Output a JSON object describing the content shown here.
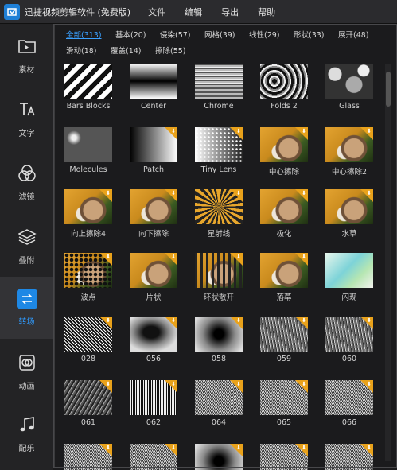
{
  "app": {
    "title": "迅捷视频剪辑软件 (免费版)"
  },
  "menu": [
    "文件",
    "编辑",
    "导出",
    "帮助"
  ],
  "sidebar": [
    {
      "label": "素材",
      "icon": "folder-icon",
      "active": false
    },
    {
      "label": "文字",
      "icon": "text-icon",
      "active": false
    },
    {
      "label": "滤镜",
      "icon": "filter-icon",
      "active": false
    },
    {
      "label": "叠附",
      "icon": "layers-icon",
      "active": false
    },
    {
      "label": "转场",
      "icon": "transition-icon",
      "active": true
    },
    {
      "label": "动画",
      "icon": "animation-icon",
      "active": false
    },
    {
      "label": "配乐",
      "icon": "music-icon",
      "active": false
    }
  ],
  "tabs": [
    {
      "label": "全部(313)",
      "active": true
    },
    {
      "label": "基本(20)"
    },
    {
      "label": "侵染(57)"
    },
    {
      "label": "网格(39)"
    },
    {
      "label": "线性(29)"
    },
    {
      "label": "形状(33)"
    },
    {
      "label": "展开(48)"
    },
    {
      "label": "滑动(18)"
    },
    {
      "label": "覆盖(14)"
    },
    {
      "label": "擦除(55)"
    }
  ],
  "transitions": [
    {
      "name": "Bars Blocks",
      "style": "bars",
      "download": false
    },
    {
      "name": "Center",
      "style": "center",
      "download": false
    },
    {
      "name": "Chrome",
      "style": "chrome",
      "download": false
    },
    {
      "name": "Folds 2",
      "style": "folds",
      "download": false
    },
    {
      "name": "Glass",
      "style": "glass",
      "download": false
    },
    {
      "name": "Molecules",
      "style": "molecules",
      "download": false
    },
    {
      "name": "Patch",
      "style": "patch",
      "download": true
    },
    {
      "name": "Tiny Lens",
      "style": "tinylens",
      "download": true
    },
    {
      "name": "中心擦除",
      "style": "cat",
      "download": true
    },
    {
      "name": "中心擦除2",
      "style": "cat",
      "download": true
    },
    {
      "name": "向上擦除4",
      "style": "cat",
      "download": true
    },
    {
      "name": "向下擦除",
      "style": "cat",
      "download": true
    },
    {
      "name": "星射线",
      "style": "rays",
      "download": true
    },
    {
      "name": "极化",
      "style": "cat",
      "download": true
    },
    {
      "name": "水草",
      "style": "cat",
      "download": true
    },
    {
      "name": "波点",
      "style": "dots",
      "download": true
    },
    {
      "name": "片状",
      "style": "cat",
      "download": true
    },
    {
      "name": "环状散开",
      "style": "ring",
      "download": true
    },
    {
      "name": "落幕",
      "style": "cat",
      "download": true
    },
    {
      "name": "闪现",
      "style": "flash",
      "download": false
    },
    {
      "name": "028",
      "style": "noise",
      "download": true
    },
    {
      "name": "056",
      "style": "blob",
      "download": true
    },
    {
      "name": "058",
      "style": "radial",
      "download": true
    },
    {
      "name": "059",
      "style": "streak",
      "download": true
    },
    {
      "name": "060",
      "style": "streak",
      "download": true
    },
    {
      "name": "061",
      "style": "scratch",
      "download": true
    },
    {
      "name": "062",
      "style": "vgrad",
      "download": true
    },
    {
      "name": "064",
      "style": "noise2",
      "download": true
    },
    {
      "name": "065",
      "style": "noise2",
      "download": true
    },
    {
      "name": "066",
      "style": "noise2",
      "download": true
    },
    {
      "name": "",
      "style": "noise2",
      "download": true
    },
    {
      "name": "",
      "style": "noise2",
      "download": true
    },
    {
      "name": "",
      "style": "radial",
      "download": true
    },
    {
      "name": "",
      "style": "noise2",
      "download": true
    },
    {
      "name": "",
      "style": "noise2",
      "download": true
    }
  ]
}
